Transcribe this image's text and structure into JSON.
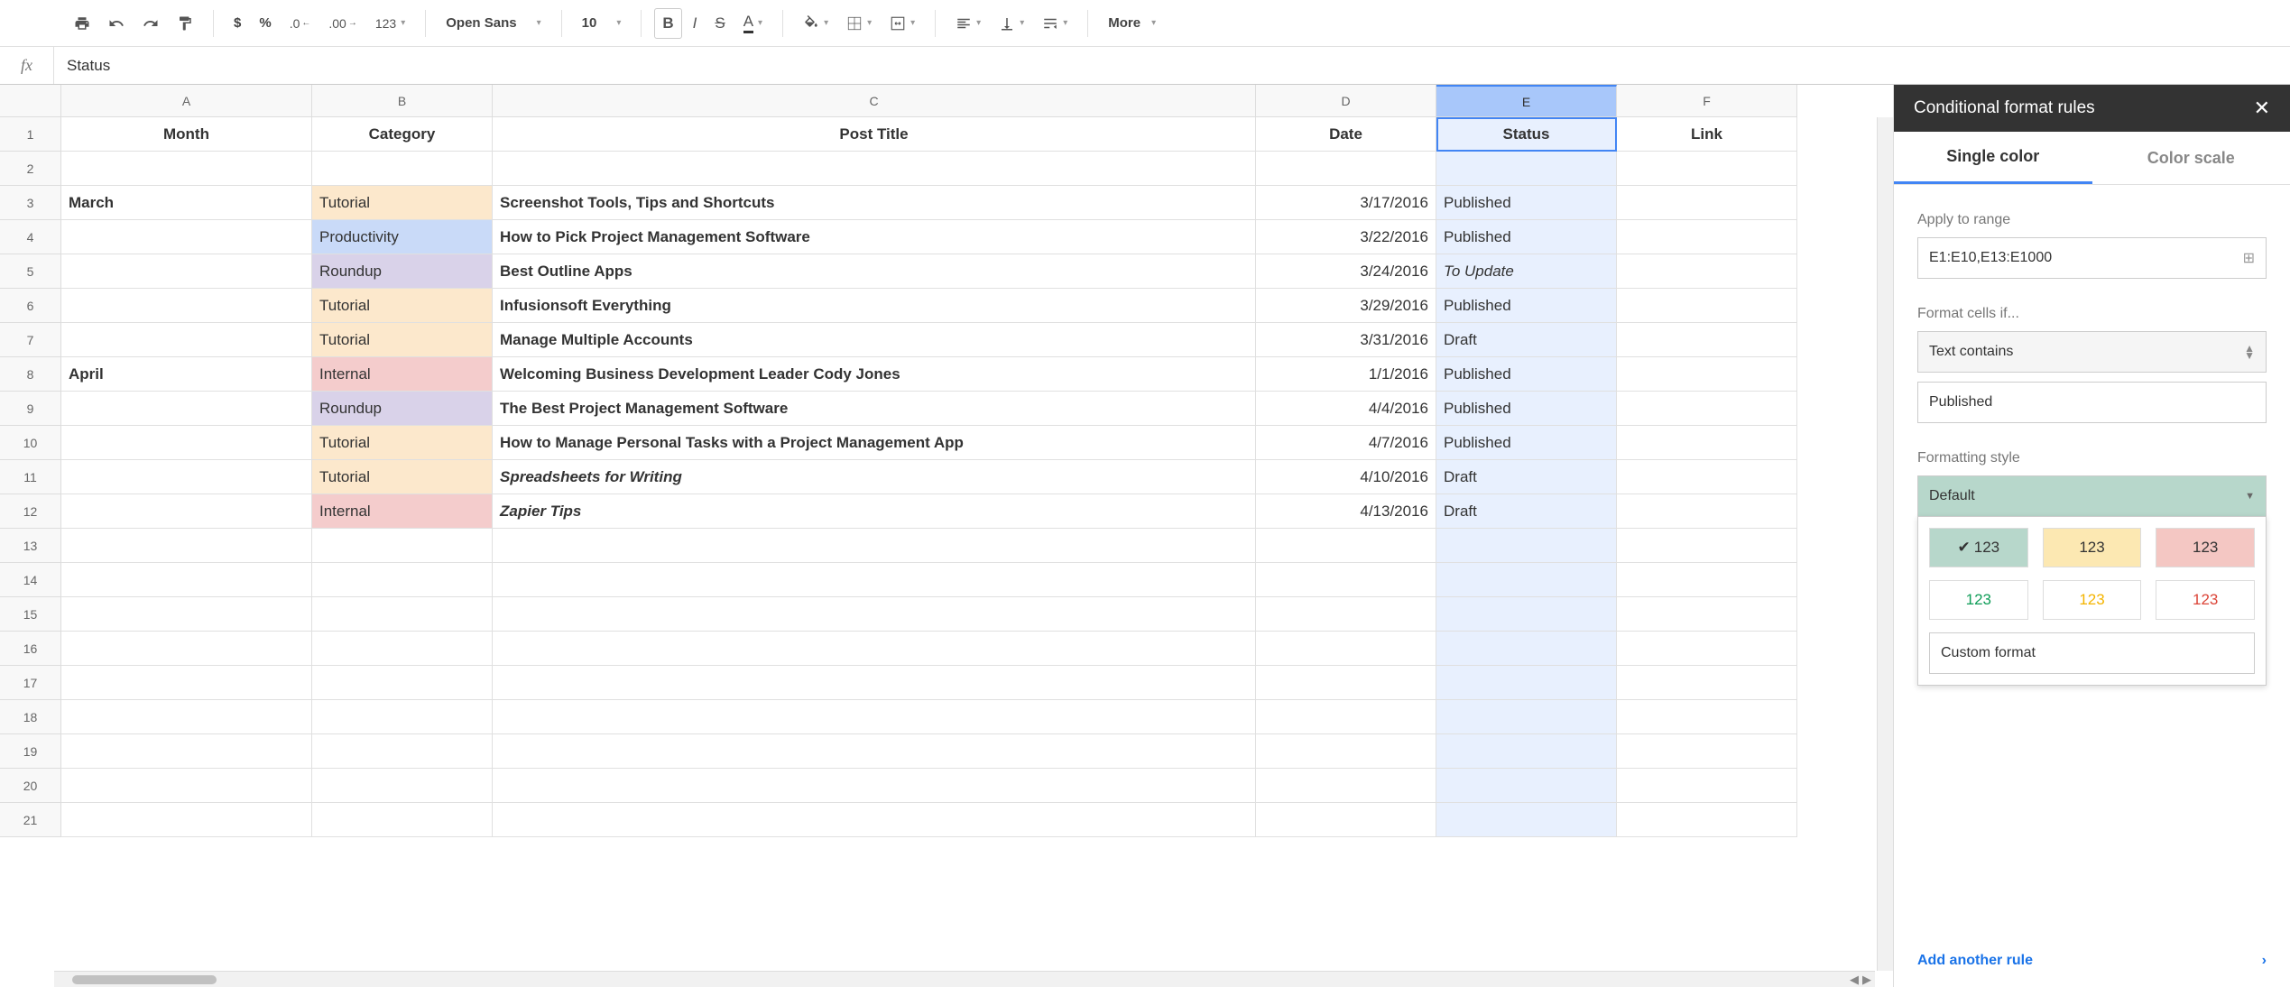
{
  "toolbar": {
    "currency": "$",
    "percent": "%",
    "dec_less": ".0",
    "dec_more": ".00",
    "num_fmt": "123",
    "font": "Open Sans",
    "font_size": "10",
    "bold": "B",
    "italic": "I",
    "strike": "S",
    "text_color": "A",
    "more": "More"
  },
  "formula_bar": {
    "fx": "fx",
    "value": "Status"
  },
  "columns": [
    "A",
    "B",
    "C",
    "D",
    "E",
    "F"
  ],
  "headers": {
    "month": "Month",
    "category": "Category",
    "title": "Post Title",
    "date": "Date",
    "status": "Status",
    "link": "Link"
  },
  "rows": [
    {
      "n": 1,
      "is_header": true
    },
    {
      "n": 2
    },
    {
      "n": 3,
      "month": "March",
      "category": "Tutorial",
      "cat_cls": "cat-tutorial",
      "title": "Screenshot Tools, Tips and Shortcuts",
      "date": "3/17/2016",
      "status": "Published",
      "st_cls": "st-published"
    },
    {
      "n": 4,
      "category": "Productivity",
      "cat_cls": "cat-productivity",
      "title": "How to Pick Project Management Software",
      "date": "3/22/2016",
      "status": "Published",
      "st_cls": "st-published"
    },
    {
      "n": 5,
      "category": "Roundup",
      "cat_cls": "cat-roundup",
      "title": "Best Outline Apps",
      "date": "3/24/2016",
      "status": "To Update",
      "st_cls": "st-toupdate"
    },
    {
      "n": 6,
      "category": "Tutorial",
      "cat_cls": "cat-tutorial",
      "title": "Infusionsoft Everything",
      "date": "3/29/2016",
      "status": "Published",
      "st_cls": "st-published"
    },
    {
      "n": 7,
      "category": "Tutorial",
      "cat_cls": "cat-tutorial",
      "title": "Manage Multiple Accounts",
      "date": "3/31/2016",
      "status": "Draft",
      "st_cls": "st-draft"
    },
    {
      "n": 8,
      "month": "April",
      "category": "Internal",
      "cat_cls": "cat-internal",
      "title": "Welcoming Business Development Leader Cody Jones",
      "date": "1/1/2016",
      "status": "Published",
      "st_cls": "st-published"
    },
    {
      "n": 9,
      "category": "Roundup",
      "cat_cls": "cat-roundup",
      "title": "The Best Project Management Software",
      "date": "4/4/2016",
      "status": "Published",
      "st_cls": "st-published"
    },
    {
      "n": 10,
      "category": "Tutorial",
      "cat_cls": "cat-tutorial",
      "title": "How to Manage Personal Tasks with a Project Management App",
      "date": "4/7/2016",
      "status": "Published",
      "st_cls": "st-published"
    },
    {
      "n": 11,
      "category": "Tutorial",
      "cat_cls": "cat-tutorial",
      "title": "Spreadsheets for Writing",
      "title_italic": true,
      "date": "4/10/2016",
      "status": "Draft",
      "st_cls": "st-draft"
    },
    {
      "n": 12,
      "category": "Internal",
      "cat_cls": "cat-internal",
      "title": "Zapier Tips",
      "title_italic": true,
      "date": "4/13/2016",
      "status": "Draft",
      "st_cls": "st-draft"
    },
    {
      "n": 13
    },
    {
      "n": 14
    },
    {
      "n": 15
    },
    {
      "n": 16
    },
    {
      "n": 17
    },
    {
      "n": 18
    },
    {
      "n": 19
    },
    {
      "n": 20
    },
    {
      "n": 21
    }
  ],
  "selected_col": "E",
  "sidebar": {
    "title": "Conditional format rules",
    "tab_single": "Single color",
    "tab_scale": "Color scale",
    "apply_label": "Apply to range",
    "range": "E1:E10,E13:E1000",
    "format_if_label": "Format cells if...",
    "condition": "Text contains",
    "condition_value": "Published",
    "style_label": "Formatting style",
    "style_default": "Default",
    "swatch_label": "123",
    "custom_format": "Custom format",
    "add_rule": "Add another rule"
  }
}
